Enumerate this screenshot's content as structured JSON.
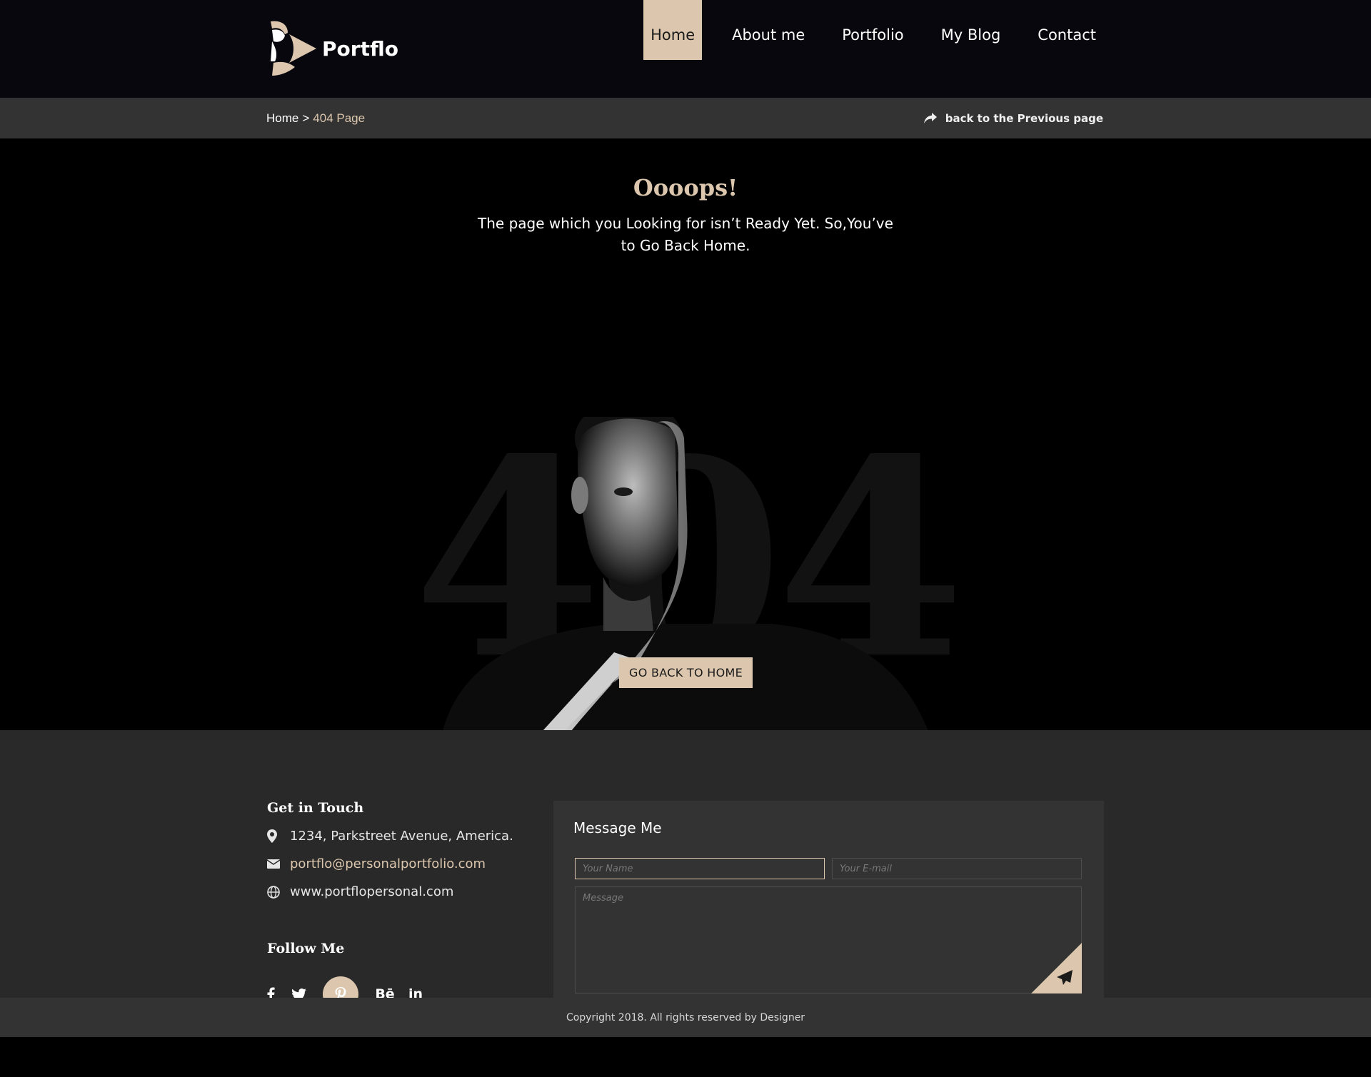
{
  "brand": {
    "name": "Portflo",
    "accent": "#dcc7ae"
  },
  "nav": {
    "items": [
      {
        "label": "Home",
        "active": true
      },
      {
        "label": "About me"
      },
      {
        "label": "Portfolio"
      },
      {
        "label": "My Blog"
      },
      {
        "label": "Contact"
      }
    ]
  },
  "breadcrumb": {
    "home": "Home",
    "separator": ">",
    "current": "404 Page",
    "back_label": "back to the Previous page",
    "back_icon": "share-arrow-icon"
  },
  "hero": {
    "title": "Oooops!",
    "text": "The page which you Looking for isn’t Ready Yet. So,You’ve to Go Back Home.",
    "bg_number": "404",
    "button_label": "GO BACK TO HOME"
  },
  "footer": {
    "contact_heading": "Get in Touch",
    "address": "1234, Parkstreet Avenue, America.",
    "email": "portflo@personalportfolio.com",
    "website": "www.portflopersonal.com",
    "follow_heading": "Follow Me",
    "socials": [
      {
        "icon": "facebook-icon",
        "glyph": "f"
      },
      {
        "icon": "twitter-icon",
        "glyph": ""
      },
      {
        "icon": "pinterest-icon",
        "glyph": "",
        "active": true
      },
      {
        "icon": "behance-icon",
        "glyph": "Bē"
      },
      {
        "icon": "linkedin-icon",
        "glyph": "in"
      }
    ],
    "message": {
      "title": "Message Me",
      "name_placeholder": "Your Name",
      "email_placeholder": "Your E-mail",
      "message_placeholder": "Message"
    },
    "copyright": "Copyright 2018. All rights reserved by Designer"
  }
}
